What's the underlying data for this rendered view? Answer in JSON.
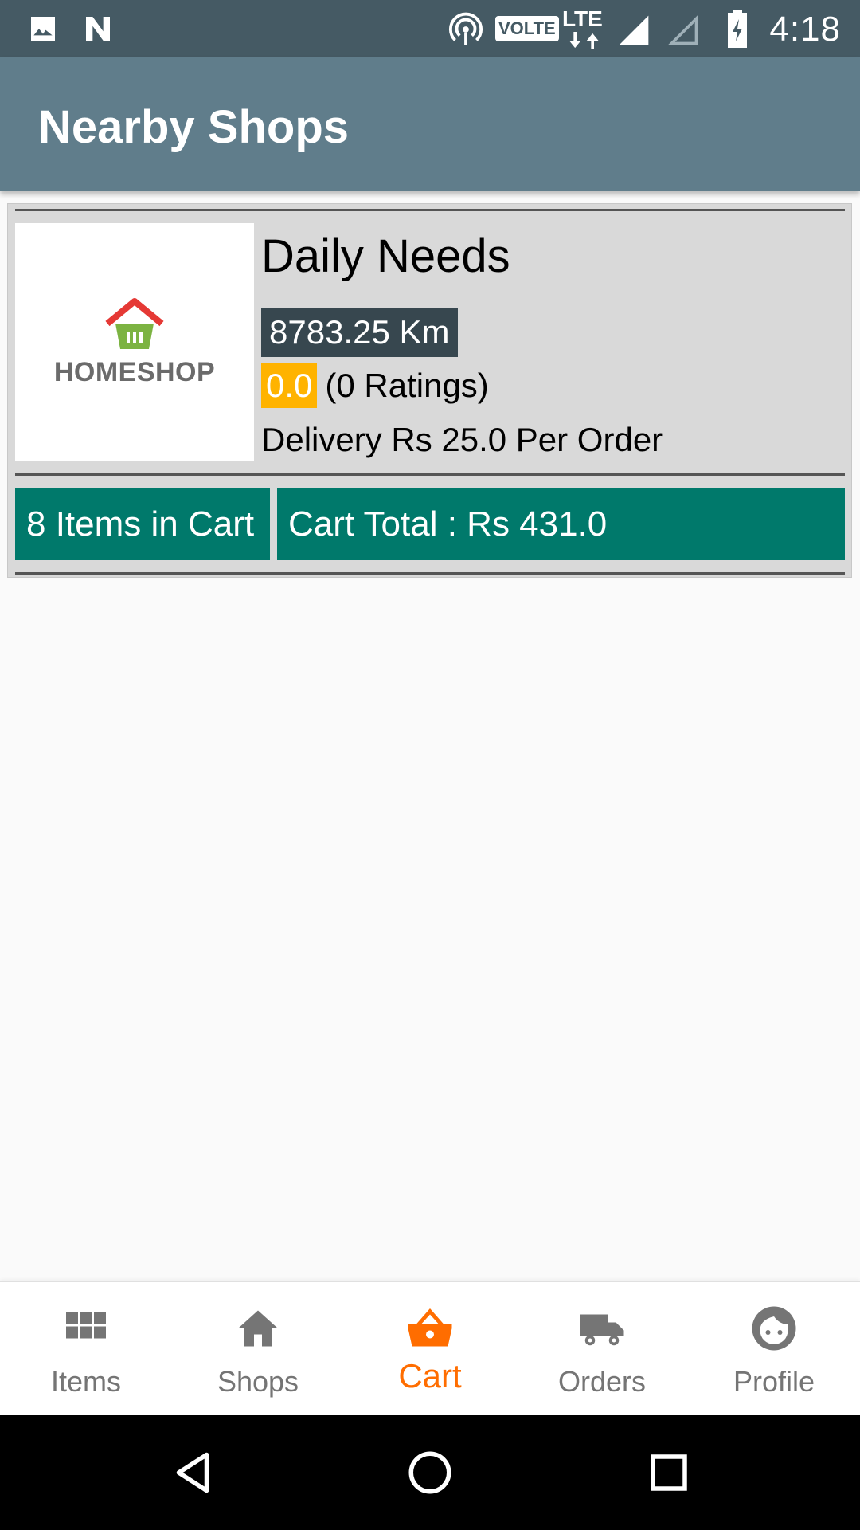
{
  "status_bar": {
    "time": "4:18",
    "volte_label": "VOLTE",
    "network_label": "LTE"
  },
  "app_bar": {
    "title": "Nearby Shops"
  },
  "shop": {
    "logo_text": "HOMESHOP",
    "name": "Daily Needs",
    "distance": "8783.25 Km",
    "rating": "0.0",
    "ratings_count": "(0 Ratings)",
    "delivery": "Delivery Rs 25.0 Per Order",
    "cart_items": "8 Items in Cart",
    "cart_total": "Cart Total : Rs 431.0"
  },
  "bottom_nav": {
    "items": [
      {
        "label": "Items",
        "icon": "grid-icon"
      },
      {
        "label": "Shops",
        "icon": "home-icon"
      },
      {
        "label": "Cart",
        "icon": "basket-icon",
        "active": true
      },
      {
        "label": "Orders",
        "icon": "truck-icon"
      },
      {
        "label": "Profile",
        "icon": "face-icon"
      }
    ],
    "active_color": "#ff6d00",
    "inactive_color": "#757575"
  },
  "colors": {
    "status_bar": "#455a64",
    "app_bar": "#607d8b",
    "cart_button": "#00796b",
    "distance_badge": "#37474f",
    "rating_badge": "#ffb300"
  }
}
